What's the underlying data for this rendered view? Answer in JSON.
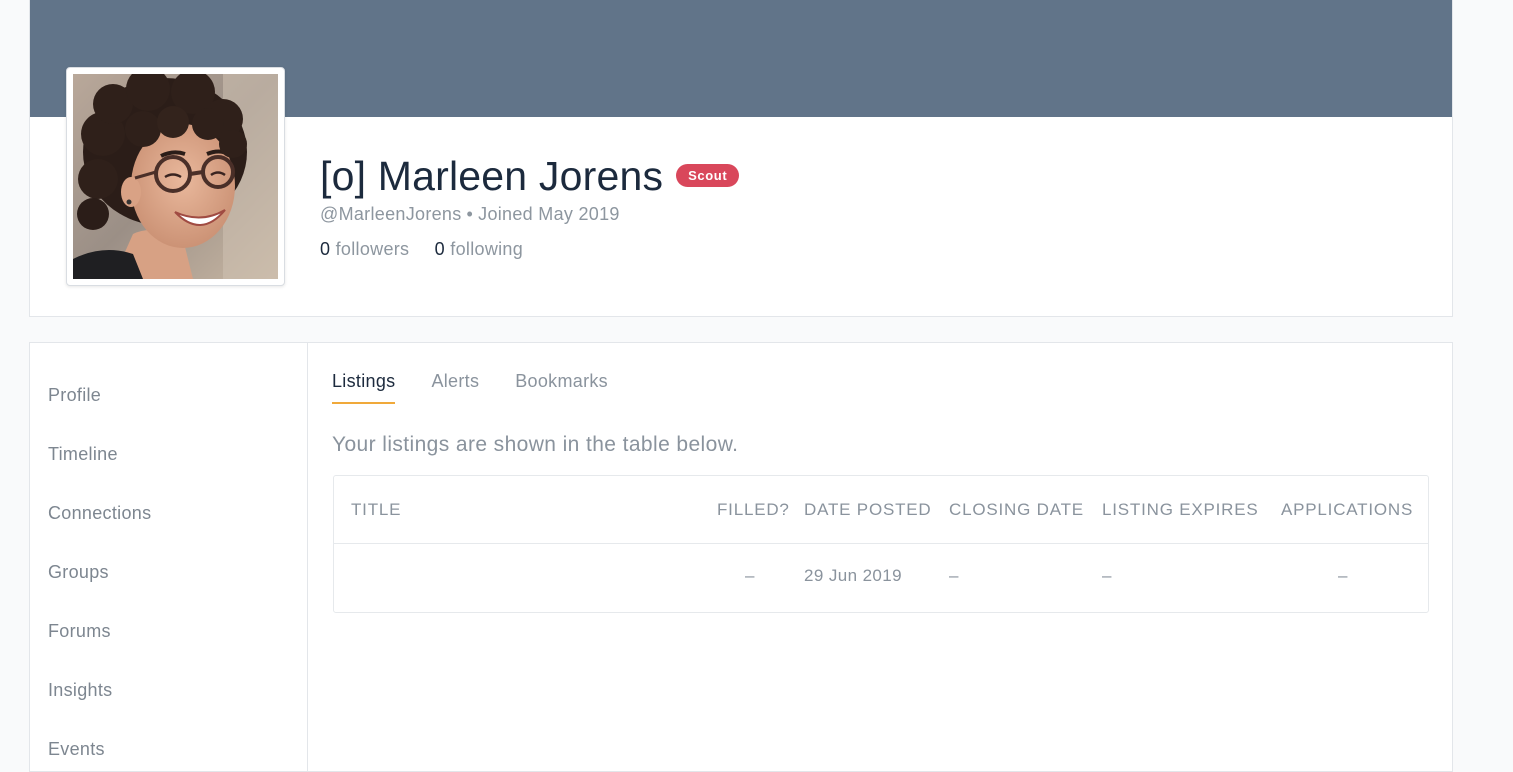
{
  "profile": {
    "name": "[o] Marleen Jorens",
    "role_badge": "Scout",
    "handle": "@MarleenJorens",
    "separator": "•",
    "joined": "Joined May 2019",
    "followers_count": "0",
    "followers_label": "followers",
    "following_count": "0",
    "following_label": "following",
    "avatar_alt": "Profile photo of smiling woman with curly hair and glasses"
  },
  "colors": {
    "cover": "#617489",
    "badge": "#d9475b",
    "tab_accent": "#f0a93a"
  },
  "sidebar": {
    "items": [
      {
        "label": "Profile"
      },
      {
        "label": "Timeline"
      },
      {
        "label": "Connections"
      },
      {
        "label": "Groups"
      },
      {
        "label": "Forums"
      },
      {
        "label": "Insights"
      },
      {
        "label": "Events"
      }
    ]
  },
  "tabs": [
    {
      "label": "Listings",
      "active": true
    },
    {
      "label": "Alerts",
      "active": false
    },
    {
      "label": "Bookmarks",
      "active": false
    }
  ],
  "listings": {
    "intro": "Your listings are shown in the table below.",
    "columns": [
      "Title",
      "Filled?",
      "Date Posted",
      "Closing Date",
      "Listing Expires",
      "Applications"
    ],
    "rows": [
      {
        "title": "",
        "filled": "–",
        "date_posted": "29 Jun 2019",
        "closing_date": "–",
        "listing_expires": "–",
        "applications": "–"
      }
    ]
  }
}
